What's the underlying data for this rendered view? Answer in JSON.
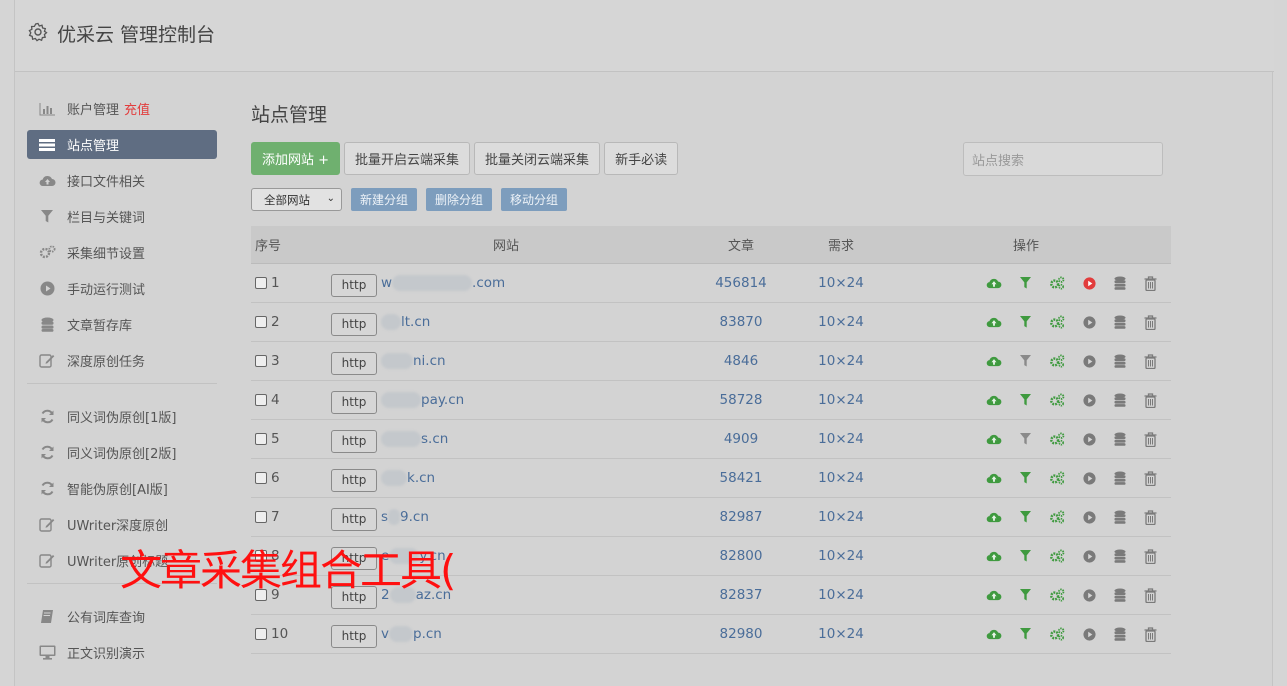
{
  "app": {
    "title": "优采云 管理控制台"
  },
  "sidebar": {
    "group1": [
      {
        "label": "账户管理",
        "extra": "充值",
        "icon": "bar-chart-icon"
      },
      {
        "label": "站点管理",
        "icon": "list-icon",
        "active": true
      },
      {
        "label": "接口文件相关",
        "icon": "cloud-upload-icon"
      },
      {
        "label": "栏目与关键词",
        "icon": "filter-icon"
      },
      {
        "label": "采集细节设置",
        "icon": "cogs-icon"
      },
      {
        "label": "手动运行测试",
        "icon": "play-icon"
      },
      {
        "label": "文章暂存库",
        "icon": "database-icon"
      },
      {
        "label": "深度原创任务",
        "icon": "edit-icon"
      }
    ],
    "group2": [
      {
        "label": "同义词伪原创[1版]",
        "icon": "refresh-icon"
      },
      {
        "label": "同义词伪原创[2版]",
        "icon": "refresh-icon"
      },
      {
        "label": "智能伪原创[AI版]",
        "icon": "refresh-icon"
      },
      {
        "label": "UWriter深度原创",
        "icon": "edit-icon"
      },
      {
        "label": "UWriter原创标题",
        "icon": "edit-icon"
      }
    ],
    "group3": [
      {
        "label": "公有词库查询",
        "icon": "book-icon"
      },
      {
        "label": "正文识别演示",
        "icon": "monitor-icon"
      }
    ]
  },
  "main": {
    "title": "站点管理",
    "toolbar": {
      "add_site": "添加网站 +",
      "batch_open": "批量开启云端采集",
      "batch_close": "批量关闭云端采集",
      "newbie": "新手必读"
    },
    "search_placeholder": "站点搜索",
    "group_select": "全部网站",
    "group_buttons": {
      "new": "新建分组",
      "delete": "删除分组",
      "move": "移动分组"
    },
    "table": {
      "headers": {
        "no": "序号",
        "site": "网站",
        "articles": "文章",
        "need": "需求",
        "ops": "操作"
      },
      "rows": [
        {
          "no": "1",
          "http": "http",
          "prefix": "w",
          "blur": 80,
          "suffix": ".com",
          "articles": "456814",
          "need": "10×24",
          "filter_on": true,
          "run_active": true
        },
        {
          "no": "2",
          "http": "http",
          "prefix": "",
          "blur": 20,
          "suffix": "lt.cn",
          "articles": "83870",
          "need": "10×24",
          "filter_on": true,
          "run_active": false
        },
        {
          "no": "3",
          "http": "http",
          "prefix": "",
          "blur": 32,
          "suffix": "ni.cn",
          "articles": "4846",
          "need": "10×24",
          "filter_on": false,
          "run_active": false
        },
        {
          "no": "4",
          "http": "http",
          "prefix": "",
          "blur": 40,
          "suffix": "pay.cn",
          "articles": "58728",
          "need": "10×24",
          "filter_on": true,
          "run_active": false
        },
        {
          "no": "5",
          "http": "http",
          "prefix": "",
          "blur": 40,
          "suffix": "s.cn",
          "articles": "4909",
          "need": "10×24",
          "filter_on": false,
          "run_active": false
        },
        {
          "no": "6",
          "http": "http",
          "prefix": "",
          "blur": 26,
          "suffix": "k.cn",
          "articles": "58421",
          "need": "10×24",
          "filter_on": true,
          "run_active": false
        },
        {
          "no": "7",
          "http": "http",
          "prefix": "s",
          "blur": 12,
          "suffix": "9.cn",
          "articles": "82987",
          "need": "10×24",
          "filter_on": true,
          "run_active": false
        },
        {
          "no": "8",
          "http": "http",
          "prefix": "e",
          "blur": 30,
          "suffix": "y.cn",
          "articles": "82800",
          "need": "10×24",
          "filter_on": true,
          "run_active": false
        },
        {
          "no": "9",
          "http": "http",
          "prefix": "2",
          "blur": 26,
          "suffix": "az.cn",
          "articles": "82837",
          "need": "10×24",
          "filter_on": true,
          "run_active": false
        },
        {
          "no": "10",
          "http": "http",
          "prefix": "v",
          "blur": 24,
          "suffix": "p.cn",
          "articles": "82980",
          "need": "10×24",
          "filter_on": true,
          "run_active": false
        }
      ]
    }
  },
  "overlay": {
    "text": "文章采集组合工具("
  },
  "colors": {
    "active_nav": "#5f6d82",
    "green": "#3f9a3f",
    "red_play": "#e23c3c",
    "link": "#4a6d99",
    "overlay_red": "#ff1010"
  }
}
